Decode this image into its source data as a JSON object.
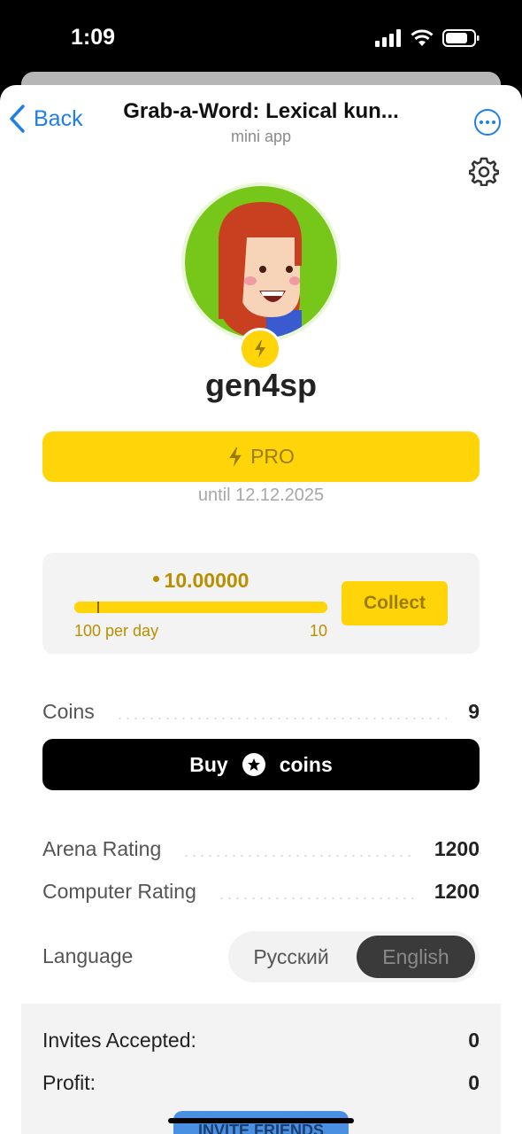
{
  "status_bar": {
    "time": "1:09"
  },
  "nav": {
    "back_label": "Back",
    "title": "Grab-a-Word: Lexical kun...",
    "subtitle": "mini app"
  },
  "profile": {
    "username": "gen4sp"
  },
  "pro": {
    "label": "PRO",
    "until": "until 12.12.2025"
  },
  "energy": {
    "amount": "10.00000",
    "rate_label": "100 per day",
    "max_label": "10",
    "fill_fraction": 1.0,
    "collect_label": "Collect"
  },
  "coins": {
    "label": "Coins",
    "value": "9",
    "buy_prefix": "Buy",
    "buy_suffix": "coins"
  },
  "ratings": [
    {
      "label": "Arena Rating",
      "value": "1200"
    },
    {
      "label": "Computer Rating",
      "value": "1200"
    }
  ],
  "language": {
    "label": "Language",
    "options": [
      "Русский",
      "English"
    ],
    "selected": "English"
  },
  "invites": {
    "accepted_label": "Invites Accepted:",
    "accepted_value": "0",
    "profit_label": "Profit:",
    "profit_value": "0",
    "button_label": "INVITE FRIENDS"
  },
  "colors": {
    "accent": "#ffd50a",
    "link": "#1f7fe6",
    "avatar_bg": "#77c71a"
  },
  "icons": [
    "chevron-left-icon",
    "more-icon",
    "settings-icon",
    "lightning-icon",
    "star-coin-icon",
    "signal-icon",
    "wifi-icon",
    "battery-icon"
  ]
}
